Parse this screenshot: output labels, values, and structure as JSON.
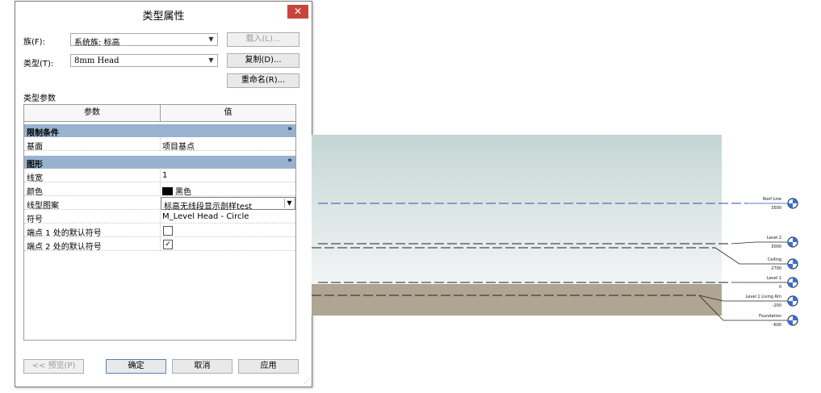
{
  "dialog": {
    "title": "类型属性",
    "close_glyph": "✕",
    "family_label": "族(F):",
    "family_value": "系统族: 标高",
    "type_label": "类型(T):",
    "type_value": "8mm Head",
    "load_button": "载入(L)...",
    "duplicate_button": "复制(D)...",
    "rename_button": "重命名(R)...",
    "type_params_label": "类型参数",
    "grid": {
      "col_param": "参数",
      "col_value": "值",
      "groups": [
        {
          "name": "限制条件",
          "collapse_glyph": "»"
        },
        {
          "name": "图形",
          "collapse_glyph": "»"
        }
      ],
      "rows": {
        "elevation_base": {
          "param": "基面",
          "value": "项目基点"
        },
        "line_weight": {
          "param": "线宽",
          "value": "1"
        },
        "color": {
          "param": "颜色",
          "value": "黑色",
          "swatch": "#000000"
        },
        "line_pattern": {
          "param": "线型图案",
          "value": "标高无线段显示剖样test"
        },
        "symbol": {
          "param": "符号",
          "value": "M_Level Head - Circle"
        },
        "end1_default": {
          "param": "端点 1 处的默认符号",
          "value": false
        },
        "end2_default": {
          "param": "端点 2 处的默认符号",
          "value": true
        }
      }
    },
    "preview_button": "<< 预览(P)",
    "ok_button": "确定",
    "cancel_button": "取消",
    "apply_button": "应用"
  },
  "view": {
    "levels": [
      {
        "name": "Roof Line",
        "elevation": "3500",
        "color": "#2a4fb5"
      },
      {
        "name": "Level 2",
        "elevation": "3000",
        "color": "#222222"
      },
      {
        "name": "Ceiling",
        "elevation": "2700",
        "color": "#222222"
      },
      {
        "name": "Level 1",
        "elevation": "0",
        "color": "#222222"
      },
      {
        "name": "Level 1 Living Rm",
        "elevation": "-200",
        "color": "#222222"
      },
      {
        "name": "Foundation",
        "elevation": "-600",
        "color": "#222222"
      }
    ],
    "sky_top": "#c3d6d4",
    "sky_bottom": "#f3f5f5",
    "ground": "#aea593",
    "marker_blue": "#3b6fd6"
  }
}
